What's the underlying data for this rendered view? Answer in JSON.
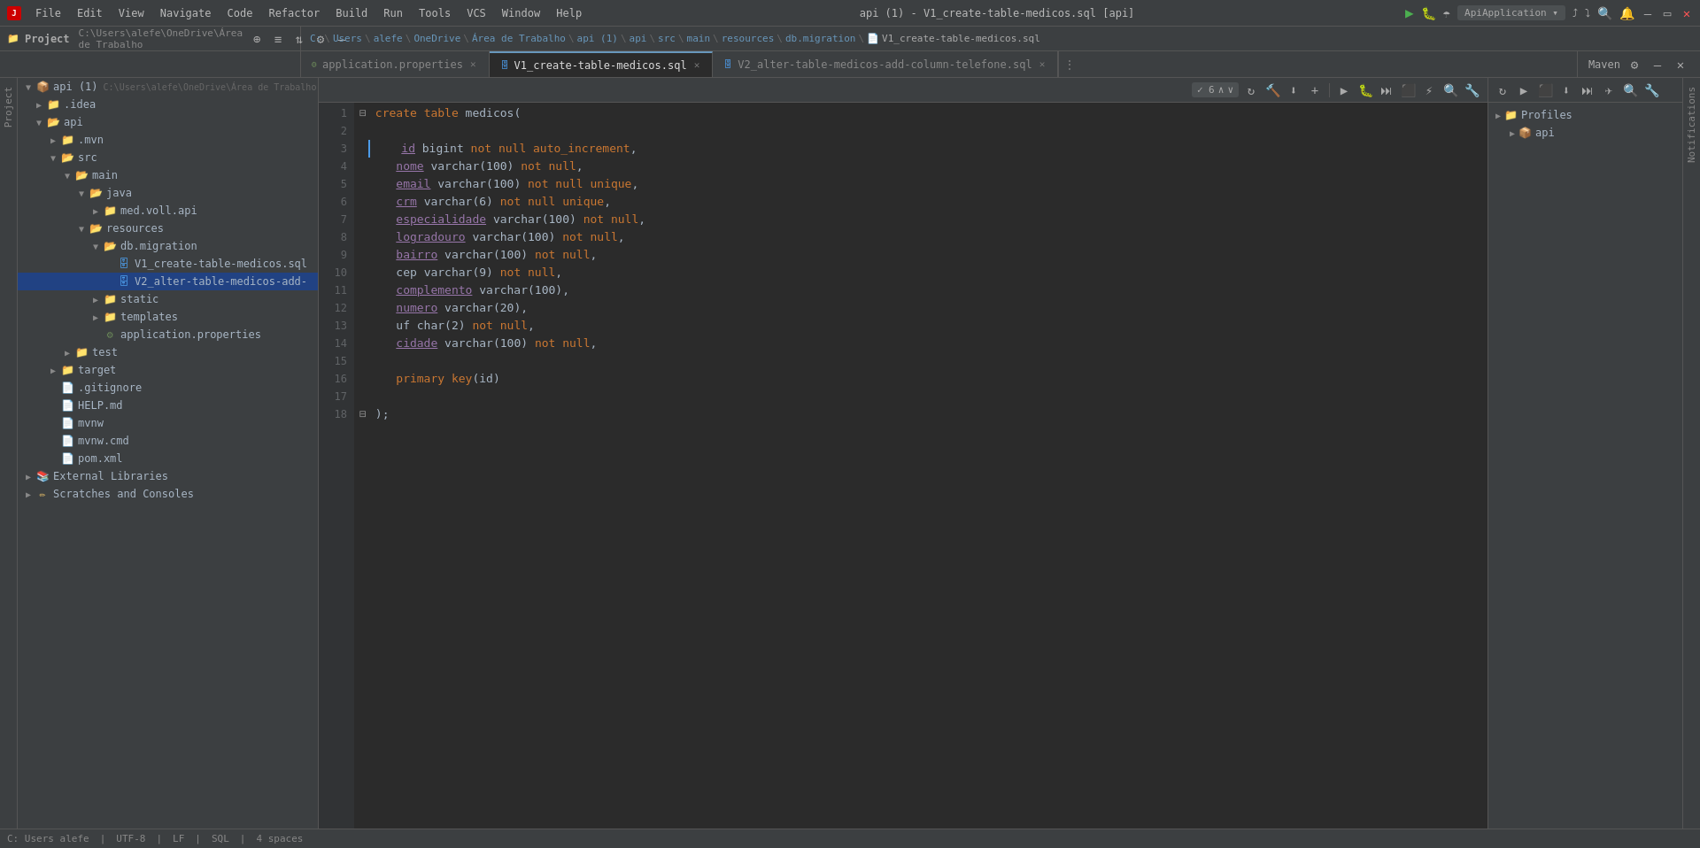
{
  "titlebar": {
    "logo": "JetBrains",
    "menus": [
      "File",
      "Edit",
      "View",
      "Navigate",
      "Code",
      "Refactor",
      "Build",
      "Run",
      "Tools",
      "VCS",
      "Window",
      "Help"
    ],
    "title": "api (1) - V1_create-table-medicos.sql [api]",
    "win_buttons": [
      "minimize",
      "maximize",
      "close"
    ]
  },
  "breadcrumb": {
    "items": [
      "C:",
      "Users",
      "alefe",
      "OneDrive",
      "Área de Trabalho",
      "api (1)",
      "api",
      "src",
      "main",
      "resources",
      "db.migration",
      "V1_create-table-medicos.sql"
    ]
  },
  "tabs": {
    "items": [
      {
        "label": "application.properties",
        "type": "props",
        "active": false,
        "closable": true
      },
      {
        "label": "V1_create-table-medicos.sql",
        "type": "sql",
        "active": true,
        "closable": true
      },
      {
        "label": "V2_alter-table-medicos-add-column-telefone.sql",
        "type": "sql",
        "active": false,
        "closable": true
      }
    ],
    "more_btn": "..."
  },
  "maven": {
    "label": "Maven",
    "toolbar_icons": [
      "settings",
      "refresh",
      "plus"
    ],
    "tree": [
      {
        "label": "Profiles",
        "expanded": false,
        "indent": 0
      },
      {
        "label": "api",
        "expanded": false,
        "indent": 1
      }
    ]
  },
  "sidebar": {
    "title": "Project",
    "path": "C:\\Users\\alefe\\OneDrive\\Área de Trabalho",
    "tree": [
      {
        "id": "api1",
        "label": "api (1)",
        "type": "project",
        "indent": 0,
        "expanded": true,
        "path": "C:\\Users\\alefe\\OneDrive\\Área de Trabalho"
      },
      {
        "id": "idea",
        "label": ".idea",
        "type": "folder-closed",
        "indent": 1,
        "expanded": false
      },
      {
        "id": "api",
        "label": "api",
        "type": "folder-open",
        "indent": 1,
        "expanded": true
      },
      {
        "id": "mvn",
        "label": ".mvn",
        "type": "folder-closed",
        "indent": 2,
        "expanded": false
      },
      {
        "id": "src",
        "label": "src",
        "type": "folder-open",
        "indent": 2,
        "expanded": true
      },
      {
        "id": "main",
        "label": "main",
        "type": "folder-open",
        "indent": 3,
        "expanded": true
      },
      {
        "id": "java",
        "label": "java",
        "type": "folder-open",
        "indent": 4,
        "expanded": true
      },
      {
        "id": "medvollapi",
        "label": "med.voll.api",
        "type": "folder-closed",
        "indent": 5,
        "expanded": false
      },
      {
        "id": "resources",
        "label": "resources",
        "type": "folder-open",
        "indent": 4,
        "expanded": true
      },
      {
        "id": "dbmigration",
        "label": "db.migration",
        "type": "folder-open",
        "indent": 5,
        "expanded": true
      },
      {
        "id": "v1sql",
        "label": "V1_create-table-medicos.sql",
        "type": "sql",
        "indent": 6,
        "expanded": false
      },
      {
        "id": "v2sql",
        "label": "V2_alter-table-medicos-add-",
        "type": "sql",
        "indent": 6,
        "expanded": false,
        "selected": true
      },
      {
        "id": "static",
        "label": "static",
        "type": "folder-closed",
        "indent": 5,
        "expanded": false
      },
      {
        "id": "templates",
        "label": "templates",
        "type": "folder-closed",
        "indent": 5,
        "expanded": false
      },
      {
        "id": "appprops",
        "label": "application.properties",
        "type": "props",
        "indent": 5,
        "expanded": false
      },
      {
        "id": "test",
        "label": "test",
        "type": "folder-closed",
        "indent": 3,
        "expanded": false
      },
      {
        "id": "target",
        "label": "target",
        "type": "folder-closed",
        "indent": 2,
        "expanded": false
      },
      {
        "id": "gitignore",
        "label": ".gitignore",
        "type": "file",
        "indent": 2,
        "expanded": false
      },
      {
        "id": "helpmd",
        "label": "HELP.md",
        "type": "md",
        "indent": 2,
        "expanded": false
      },
      {
        "id": "mvnw",
        "label": "mvnw",
        "type": "file",
        "indent": 2,
        "expanded": false
      },
      {
        "id": "mvnwcmd",
        "label": "mvnw.cmd",
        "type": "file",
        "indent": 2,
        "expanded": false
      },
      {
        "id": "pomxml",
        "label": "pom.xml",
        "type": "xml",
        "indent": 2,
        "expanded": false
      },
      {
        "id": "extlibs",
        "label": "External Libraries",
        "type": "ext-libs",
        "indent": 0,
        "expanded": false
      },
      {
        "id": "scratches",
        "label": "Scratches and Consoles",
        "type": "scratch",
        "indent": 0,
        "expanded": false
      }
    ]
  },
  "editor": {
    "filename": "V1_create-table-medicos.sql",
    "fold_count": 6,
    "lines": [
      {
        "num": 1,
        "content": "create table medicos(",
        "tokens": [
          {
            "text": "create ",
            "class": "kw"
          },
          {
            "text": "table ",
            "class": "kw"
          },
          {
            "text": "medicos(",
            "class": "plain"
          }
        ]
      },
      {
        "num": 2,
        "content": "",
        "tokens": []
      },
      {
        "num": 3,
        "content": "    id bigint not null auto_increment,",
        "tokens": [
          {
            "text": "    ",
            "class": "plain"
          },
          {
            "text": "id",
            "class": "col"
          },
          {
            "text": " ",
            "class": "plain"
          },
          {
            "text": "bigint",
            "class": "type"
          },
          {
            "text": " ",
            "class": "plain"
          },
          {
            "text": "not null",
            "class": "kw"
          },
          {
            "text": " ",
            "class": "plain"
          },
          {
            "text": "auto_increment",
            "class": "kw"
          },
          {
            "text": ",",
            "class": "plain"
          }
        ]
      },
      {
        "num": 4,
        "content": "    nome varchar(100) not null,",
        "tokens": [
          {
            "text": "    ",
            "class": "plain"
          },
          {
            "text": "nome",
            "class": "col"
          },
          {
            "text": " ",
            "class": "plain"
          },
          {
            "text": "varchar",
            "class": "type"
          },
          {
            "text": "(100)",
            "class": "plain"
          },
          {
            "text": " not null",
            "class": "kw"
          },
          {
            "text": ",",
            "class": "plain"
          }
        ]
      },
      {
        "num": 5,
        "content": "    email varchar(100) not null unique,",
        "tokens": [
          {
            "text": "    ",
            "class": "plain"
          },
          {
            "text": "email",
            "class": "col"
          },
          {
            "text": " ",
            "class": "plain"
          },
          {
            "text": "varchar",
            "class": "type"
          },
          {
            "text": "(100) ",
            "class": "plain"
          },
          {
            "text": "not null unique",
            "class": "kw"
          },
          {
            "text": ",",
            "class": "plain"
          }
        ]
      },
      {
        "num": 6,
        "content": "    crm varchar(6) not null unique,",
        "tokens": [
          {
            "text": "    ",
            "class": "plain"
          },
          {
            "text": "crm",
            "class": "col"
          },
          {
            "text": " ",
            "class": "plain"
          },
          {
            "text": "varchar",
            "class": "type"
          },
          {
            "text": "(6) ",
            "class": "plain"
          },
          {
            "text": "not null unique",
            "class": "kw"
          },
          {
            "text": ",",
            "class": "plain"
          }
        ]
      },
      {
        "num": 7,
        "content": "    especialidade varchar(100) not null,",
        "tokens": [
          {
            "text": "    ",
            "class": "plain"
          },
          {
            "text": "especialidade",
            "class": "col"
          },
          {
            "text": " ",
            "class": "plain"
          },
          {
            "text": "varchar",
            "class": "type"
          },
          {
            "text": "(100) ",
            "class": "plain"
          },
          {
            "text": "not null",
            "class": "kw"
          },
          {
            "text": ",",
            "class": "plain"
          }
        ]
      },
      {
        "num": 8,
        "content": "    logradouro varchar(100) not null,",
        "tokens": [
          {
            "text": "    ",
            "class": "plain"
          },
          {
            "text": "logradouro",
            "class": "col"
          },
          {
            "text": " ",
            "class": "plain"
          },
          {
            "text": "varchar",
            "class": "type"
          },
          {
            "text": "(100) ",
            "class": "plain"
          },
          {
            "text": "not null",
            "class": "kw"
          },
          {
            "text": ",",
            "class": "plain"
          }
        ]
      },
      {
        "num": 9,
        "content": "    bairro varchar(100) not null,",
        "tokens": [
          {
            "text": "    ",
            "class": "plain"
          },
          {
            "text": "bairro",
            "class": "col"
          },
          {
            "text": " ",
            "class": "plain"
          },
          {
            "text": "varchar",
            "class": "type"
          },
          {
            "text": "(100) ",
            "class": "plain"
          },
          {
            "text": "not null",
            "class": "kw"
          },
          {
            "text": ",",
            "class": "plain"
          }
        ]
      },
      {
        "num": 10,
        "content": "    cep varchar(9) not null,",
        "tokens": [
          {
            "text": "    ",
            "class": "plain"
          },
          {
            "text": "cep",
            "class": "plain"
          },
          {
            "text": " ",
            "class": "plain"
          },
          {
            "text": "varchar",
            "class": "type"
          },
          {
            "text": "(9) ",
            "class": "plain"
          },
          {
            "text": "not null",
            "class": "kw"
          },
          {
            "text": ",",
            "class": "plain"
          }
        ]
      },
      {
        "num": 11,
        "content": "    complemento varchar(100),",
        "tokens": [
          {
            "text": "    ",
            "class": "plain"
          },
          {
            "text": "complemento",
            "class": "col"
          },
          {
            "text": " ",
            "class": "plain"
          },
          {
            "text": "varchar",
            "class": "type"
          },
          {
            "text": "(100),",
            "class": "plain"
          }
        ]
      },
      {
        "num": 12,
        "content": "    numero varchar(20),",
        "tokens": [
          {
            "text": "    ",
            "class": "plain"
          },
          {
            "text": "numero",
            "class": "col"
          },
          {
            "text": " ",
            "class": "plain"
          },
          {
            "text": "varchar",
            "class": "type"
          },
          {
            "text": "(20),",
            "class": "plain"
          }
        ]
      },
      {
        "num": 13,
        "content": "    uf char(2) not null,",
        "tokens": [
          {
            "text": "    ",
            "class": "plain"
          },
          {
            "text": "uf",
            "class": "plain"
          },
          {
            "text": " ",
            "class": "plain"
          },
          {
            "text": "char",
            "class": "type"
          },
          {
            "text": "(2) ",
            "class": "plain"
          },
          {
            "text": "not null",
            "class": "kw"
          },
          {
            "text": ",",
            "class": "plain"
          }
        ]
      },
      {
        "num": 14,
        "content": "    cidade varchar(100) not null,",
        "tokens": [
          {
            "text": "    ",
            "class": "plain"
          },
          {
            "text": "cidade",
            "class": "col"
          },
          {
            "text": " ",
            "class": "plain"
          },
          {
            "text": "varchar",
            "class": "type"
          },
          {
            "text": "(100) ",
            "class": "plain"
          },
          {
            "text": "not null",
            "class": "kw"
          },
          {
            "text": ",",
            "class": "plain"
          }
        ]
      },
      {
        "num": 15,
        "content": "",
        "tokens": []
      },
      {
        "num": 16,
        "content": "    primary key(id)",
        "tokens": [
          {
            "text": "    ",
            "class": "plain"
          },
          {
            "text": "primary key",
            "class": "kw"
          },
          {
            "text": "(id)",
            "class": "plain"
          }
        ]
      },
      {
        "num": 17,
        "content": "",
        "tokens": []
      },
      {
        "num": 18,
        "content": ");",
        "tokens": [
          {
            "text": ");",
            "class": "plain"
          }
        ]
      }
    ]
  },
  "vertical_tabs_left": [
    "Project"
  ],
  "vertical_tabs_right": [
    "Maven",
    "Notifications"
  ],
  "status_bar": {
    "items": [
      "C: Users alefe",
      "UTF-8",
      "LF",
      "SQL",
      "4 spaces"
    ]
  }
}
